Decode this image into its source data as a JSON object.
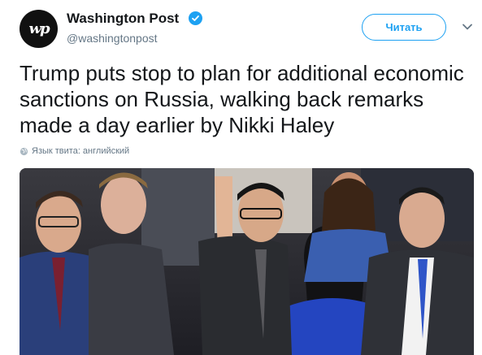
{
  "account": {
    "avatar_text": "wp",
    "name": "Washington Post",
    "handle": "@washingtonpost",
    "verified": true
  },
  "follow_button": {
    "label": "Читать"
  },
  "menu_icon": "chevron-down-icon",
  "tweet": {
    "text": "Trump puts stop to plan for additional economic sanctions on Russia, walking back remarks made a day earlier by Nikki Haley",
    "language_note": "Язык твита: английский"
  },
  "colors": {
    "accent": "#1da1f2",
    "secondary_text": "#657786",
    "primary_text": "#14171a"
  }
}
